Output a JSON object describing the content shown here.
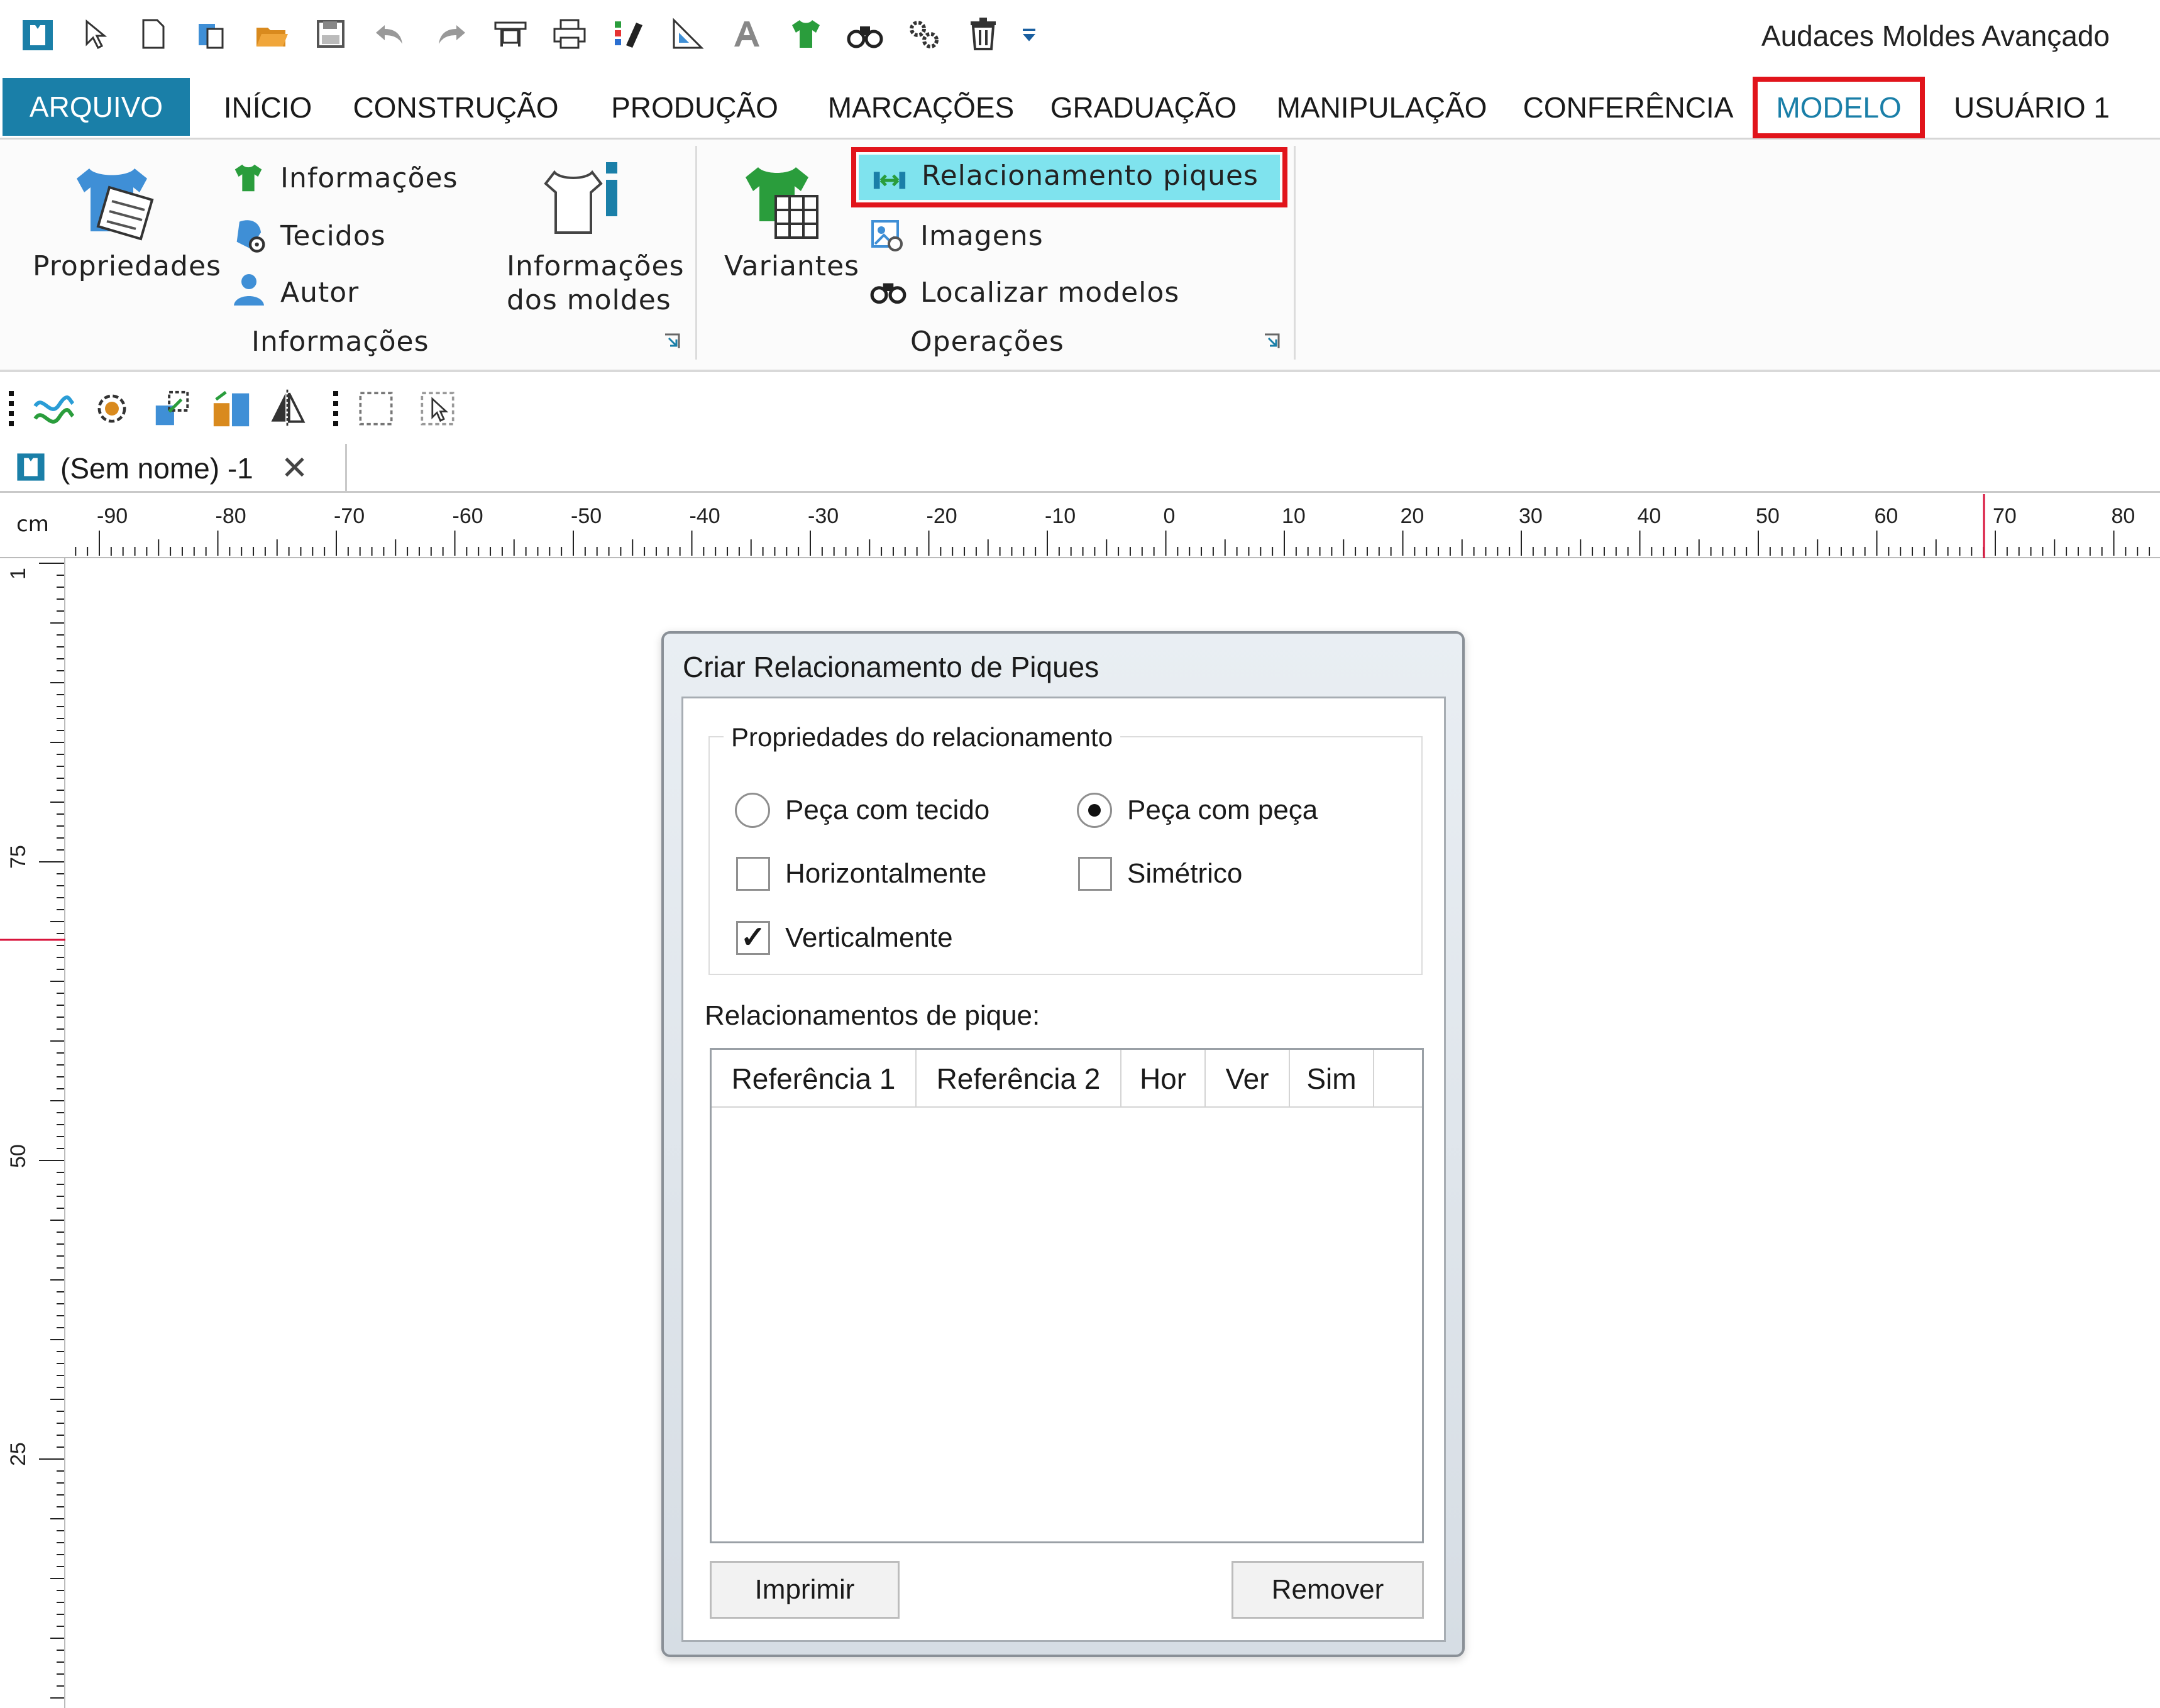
{
  "app": {
    "title": "Audaces Moldes Avançado"
  },
  "quick_access": [
    "app-logo-icon",
    "pointer-icon",
    "new-file-icon",
    "paste-icon",
    "open-folder-icon",
    "save-icon",
    "undo-icon",
    "redo-icon",
    "plotter-icon",
    "print-icon",
    "color-tools-icon",
    "ruler-square-icon",
    "font-icon",
    "shirt-icon",
    "binoculars-icon",
    "settings-icon",
    "trash-icon",
    "customize-dropdown-icon"
  ],
  "tabs": [
    {
      "label": "ARQUIVO",
      "state": "file"
    },
    {
      "label": "INÍCIO"
    },
    {
      "label": "CONSTRUÇÃO"
    },
    {
      "label": "PRODUÇÃO"
    },
    {
      "label": "MARCAÇÕES"
    },
    {
      "label": "GRADUAÇÃO"
    },
    {
      "label": "MANIPULAÇÃO"
    },
    {
      "label": "CONFERÊNCIA"
    },
    {
      "label": "MODELO",
      "state": "selected-highlighted"
    },
    {
      "label": "USUÁRIO 1"
    }
  ],
  "ribbon": {
    "informacoes_group": {
      "label": "Informações",
      "propriedades": "Propriedades",
      "items": [
        "Informações",
        "Tecidos",
        "Autor"
      ],
      "moldes_line1": "Informações",
      "moldes_line2": "dos moldes"
    },
    "operacoes_group": {
      "label": "Operações",
      "variantes": "Variantes",
      "items": [
        "Relacionamento piques",
        "Imagens",
        "Localizar modelos"
      ]
    },
    "highlight_color": "#e1141b",
    "hover_color": "#7fe3ee",
    "accent": "#1a7fa8"
  },
  "document": {
    "tab_label": "(Sem nome) -1",
    "close_glyph": "✕"
  },
  "ruler": {
    "unit": "cm",
    "horizontal_labels": [
      "-90",
      "-80",
      "-70",
      "-60",
      "-50",
      "-40",
      "-30",
      "-20",
      "-10",
      "0",
      "10",
      "20",
      "30",
      "40",
      "50",
      "60",
      "70",
      "80"
    ],
    "vertical_labels": [
      "1",
      "75",
      "50",
      "25"
    ]
  },
  "dialog": {
    "title": "Criar Relacionamento de Piques",
    "group_label": "Propriedades do relacionamento",
    "options": {
      "peca_tecido": {
        "label": "Peça com tecido",
        "checked": false
      },
      "peca_peca": {
        "label": "Peça com peça",
        "checked": true
      },
      "horizontal": {
        "label": "Horizontalmente",
        "checked": false
      },
      "simetrico": {
        "label": "Simétrico",
        "checked": false
      },
      "vertical": {
        "label": "Verticalmente",
        "checked": true
      }
    },
    "list_label": "Relacionamentos de pique:",
    "columns": [
      "Referência 1",
      "Referência 2",
      "Hor",
      "Ver",
      "Sim"
    ],
    "rows": [],
    "print_button": "Imprimir",
    "remove_button": "Remover",
    "check_glyph": "✓"
  }
}
